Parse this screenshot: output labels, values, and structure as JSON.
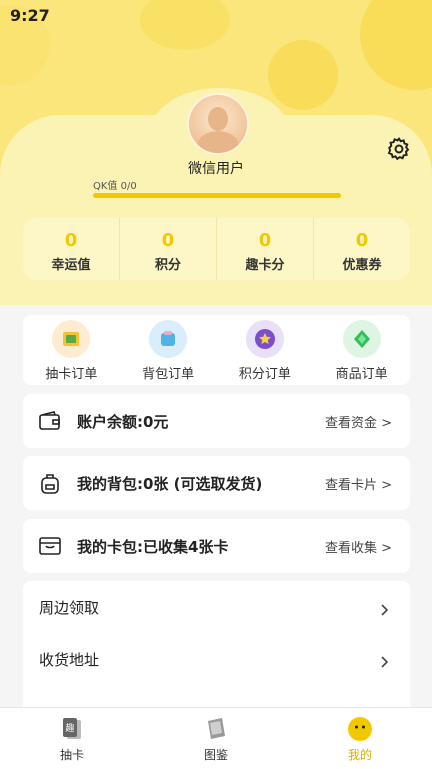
{
  "status_bar": {
    "time": "9:27"
  },
  "profile": {
    "username": "微信用户",
    "qk_label": "QK值 0/0",
    "qk_progress": 0
  },
  "stats": [
    {
      "value": "0",
      "label": "幸运值"
    },
    {
      "value": "0",
      "label": "积分"
    },
    {
      "value": "0",
      "label": "趣卡分"
    },
    {
      "value": "0",
      "label": "优惠券"
    }
  ],
  "orders": [
    {
      "label": "抽卡订单",
      "icon": "card-draw-order-icon"
    },
    {
      "label": "背包订单",
      "icon": "bag-order-icon"
    },
    {
      "label": "积分订单",
      "icon": "points-order-icon"
    },
    {
      "label": "商品订单",
      "icon": "goods-order-icon"
    }
  ],
  "account": {
    "title": "账户余额:0元",
    "link": "查看资金 >"
  },
  "backpack": {
    "title": "我的背包:0张 (可选取发货)",
    "link": "查看卡片 >"
  },
  "cardbag": {
    "title": "我的卡包:已收集4张卡",
    "link": "查看收集 >"
  },
  "menu": [
    {
      "label": "周边领取"
    },
    {
      "label": "收货地址"
    }
  ],
  "tabbar": [
    {
      "label": "抽卡",
      "icon": "draw-card-icon"
    },
    {
      "label": "图鉴",
      "icon": "catalog-icon"
    },
    {
      "label": "我的",
      "icon": "profile-face-icon"
    }
  ],
  "colors": {
    "accent": "#f2c900",
    "header_bg": "#fbe67b",
    "active_tab": "#d9ae00"
  }
}
